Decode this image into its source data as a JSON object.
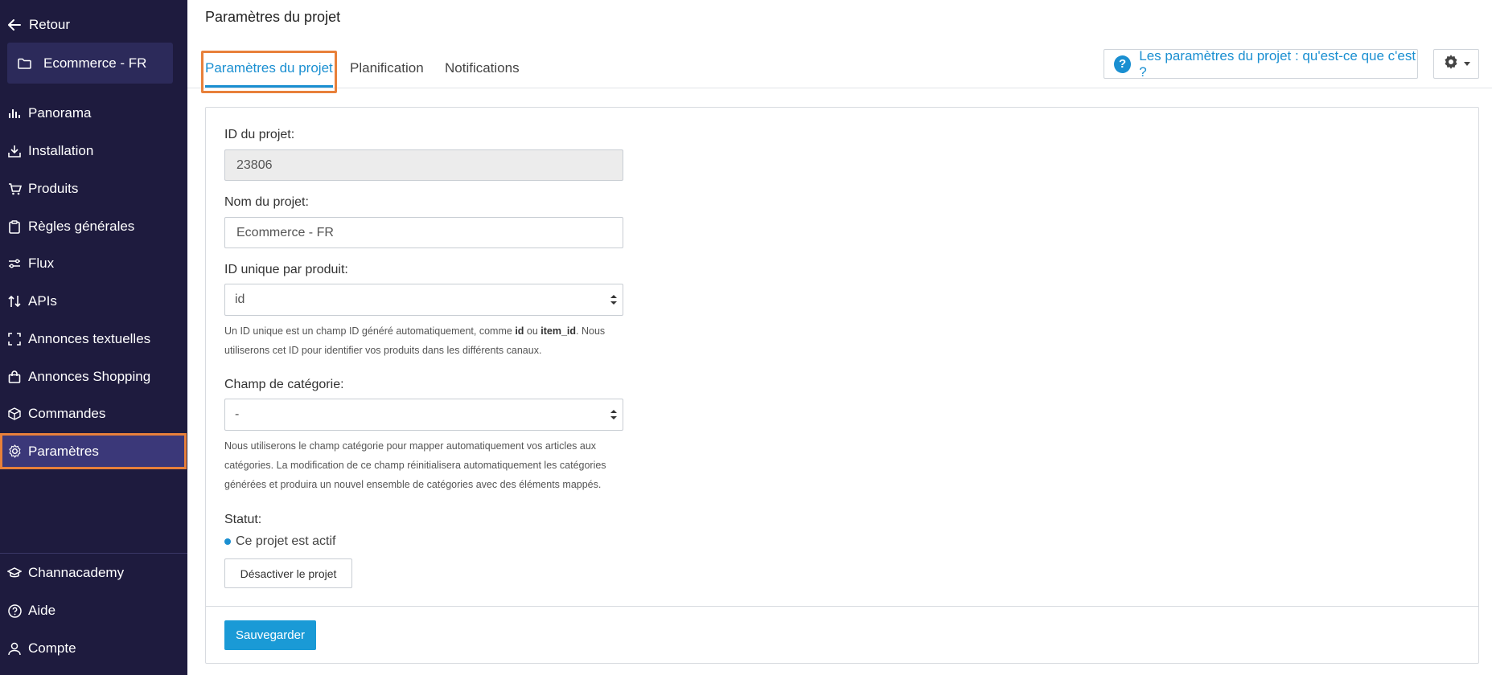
{
  "sidebar": {
    "back_label": "Retour",
    "project_name": "Ecommerce - FR",
    "items": [
      {
        "label": "Panorama",
        "icon": "bar-chart-icon"
      },
      {
        "label": "Installation",
        "icon": "download-tray-icon"
      },
      {
        "label": "Produits",
        "icon": "cart-icon"
      },
      {
        "label": "Règles générales",
        "icon": "clipboard-icon"
      },
      {
        "label": "Flux",
        "icon": "sliders-icon"
      },
      {
        "label": "APIs",
        "icon": "up-down-arrows-icon"
      },
      {
        "label": "Annonces textuelles",
        "icon": "frame-corners-icon"
      },
      {
        "label": "Annonces Shopping",
        "icon": "shopping-bag-icon"
      },
      {
        "label": "Commandes",
        "icon": "box-icon"
      },
      {
        "label": "Paramètres",
        "icon": "gear-icon",
        "active": true
      }
    ],
    "bottom_items": [
      {
        "label": "Channacademy",
        "icon": "graduation-cap-icon"
      },
      {
        "label": "Aide",
        "icon": "question-circle-icon"
      },
      {
        "label": "Compte",
        "icon": "user-icon"
      }
    ]
  },
  "header": {
    "title": "Paramètres du projet"
  },
  "tabs": [
    {
      "label": "Paramètres du projet",
      "active": true
    },
    {
      "label": "Planification"
    },
    {
      "label": "Notifications"
    }
  ],
  "help_button_label": "Les paramètres du projet : qu'est-ce que c'est ?",
  "form": {
    "project_id_label": "ID du projet:",
    "project_id_value": "23806",
    "project_name_label": "Nom du projet:",
    "project_name_value": "Ecommerce - FR",
    "unique_id_label": "ID unique par produit:",
    "unique_id_value": "id",
    "unique_id_help_1": "Un ID unique est un champ ID généré automatiquement, comme ",
    "unique_id_help_bold_1": "id",
    "unique_id_help_2": " ou ",
    "unique_id_help_bold_2": "item_id",
    "unique_id_help_3": ". Nous utiliserons cet ID pour identifier vos produits dans les différents canaux.",
    "category_label": "Champ de catégorie:",
    "category_value": "-",
    "category_help": "Nous utiliserons le champ catégorie pour mapper automatiquement vos articles aux catégories. La modification de ce champ réinitialisera automatiquement les catégories générées et produira un nouvel ensemble de catégories avec des éléments mappés.",
    "status_label": "Statut:",
    "status_value": "Ce projet est actif",
    "deactivate_label": "Désactiver le projet",
    "save_label": "Sauvegarder"
  },
  "colors": {
    "sidebar_bg": "#1e1b3e",
    "sidebar_active_bg": "#3b3879",
    "accent": "#1a8fd1",
    "highlight": "#e8803a",
    "save_bg": "#1a9ad6"
  }
}
